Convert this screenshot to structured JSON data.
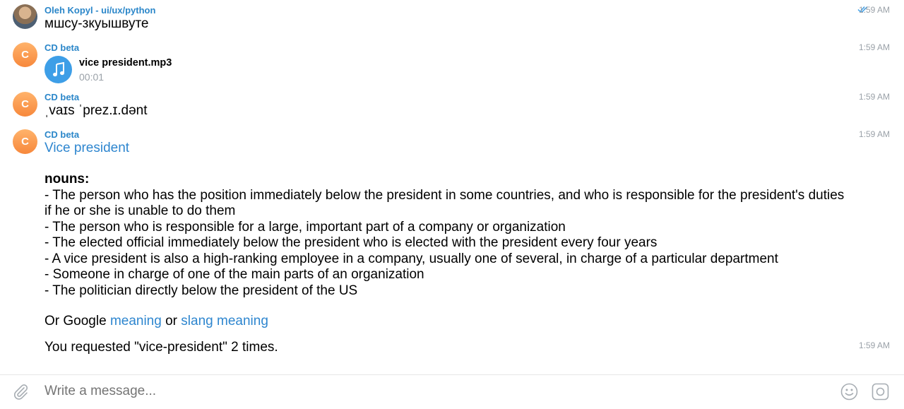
{
  "messages": [
    {
      "sender": "Oleh Kopyl - ui/ux/python",
      "time": "1:59 AM",
      "text": "мшсу-зкуышвуте",
      "read": true
    },
    {
      "sender": "CD beta",
      "avatar_letter": "C",
      "time": "1:59 AM",
      "file_name": "vice president.mp3",
      "duration": "00:01"
    },
    {
      "sender": "CD beta",
      "avatar_letter": "C",
      "time": "1:59 AM",
      "text": "ˌvaɪs ˈprez.ɪ.dənt"
    },
    {
      "sender": "CD beta",
      "avatar_letter": "C",
      "time": "1:59 AM",
      "title_link": "Vice president",
      "section": "nouns:",
      "definitions": [
        "- The person who has the position immediately below the president in some countries, and who is responsible for the president's duties if he or she is unable to do them",
        "- The person who is responsible for a large, important part of a company or organization",
        "- The elected official immediately below the president who is elected with the president every four years",
        "- A vice president is also a high-ranking employee in a company, usually one of several, in charge of a particular department",
        "- Someone in charge of one of the main parts of an organization",
        "- The politician directly below the president of the US"
      ],
      "google_prefix": "Or Google",
      "meaning_link": "meaning",
      "or_text": "or",
      "slang_link": "slang meaning"
    },
    {
      "time": "1:59 AM",
      "text": "You requested \"vice-president\" 2 times."
    }
  ],
  "composer": {
    "placeholder": "Write a message..."
  },
  "icons": {
    "attach": "paperclip-icon",
    "emoji": "emoji-icon",
    "sticker": "sticker-icon",
    "audio": "music-note-icon",
    "read": "double-check-icon"
  },
  "colors": {
    "accent": "#2a86c9",
    "link": "#2e86cf",
    "avatar": "#f7883c",
    "muted": "#9aa1a8"
  }
}
